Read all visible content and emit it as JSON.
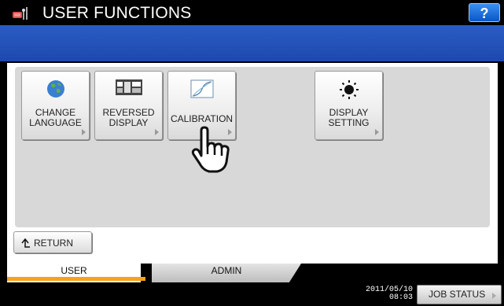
{
  "header": {
    "title": "USER FUNCTIONS",
    "help_label": "?"
  },
  "functions": [
    {
      "label_line1": "CHANGE",
      "label_line2": "LANGUAGE",
      "icon": "globe-icon"
    },
    {
      "label_line1": "REVERSED",
      "label_line2": "DISPLAY",
      "icon": "reversed-display-icon"
    },
    {
      "label_line1": "CALIBRATION",
      "label_line2": "",
      "icon": "calibration-curve-icon"
    },
    {
      "label_line1": "DISPLAY",
      "label_line2": "SETTING",
      "icon": "sun-brightness-icon"
    }
  ],
  "return_label": "RETURN",
  "tabs": [
    {
      "label": "USER"
    },
    {
      "label": "ADMIN"
    }
  ],
  "footer": {
    "date": "2011/05/10",
    "time": "08:03",
    "job_status_label": "JOB STATUS"
  },
  "colors": {
    "accent_tab": "#f7a21b",
    "header_band": "#1d49ad"
  }
}
